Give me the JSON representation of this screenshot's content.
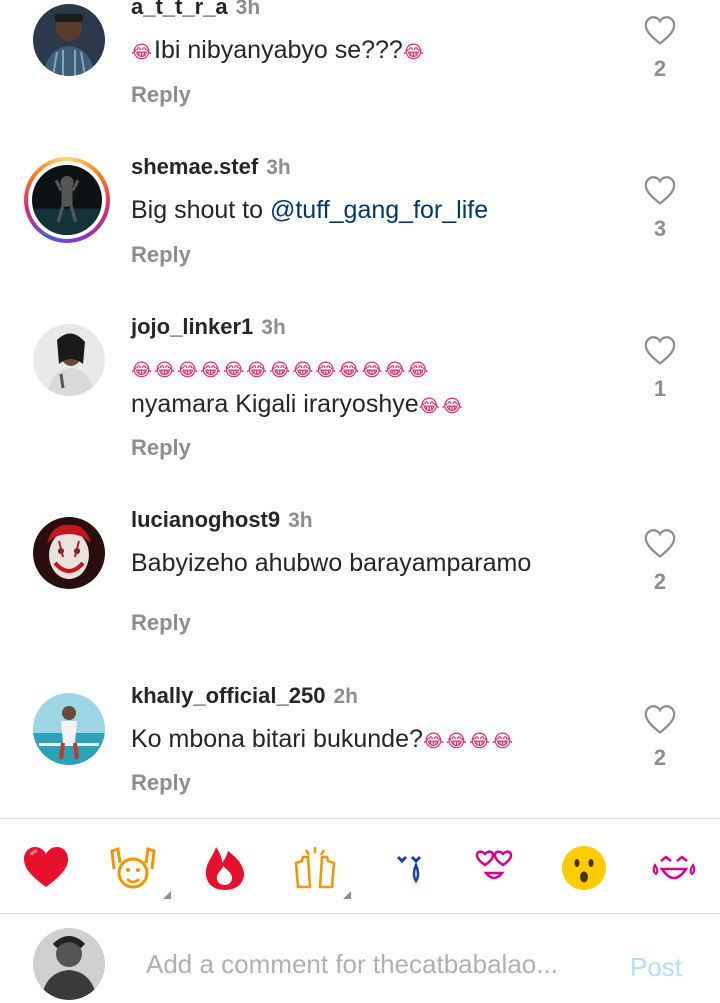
{
  "comments": [
    {
      "username": "a_t_t_r_a",
      "time": "3h",
      "text": "Ibi nibyanyabyo se???",
      "emoji_before": "😂",
      "emoji_after": "😂",
      "likes": "2",
      "reply": "Reply",
      "avatar": "man-in-plaid-shirt"
    },
    {
      "username": "shemae.stef",
      "time": "3h",
      "text_prefix": "Big shout to ",
      "mention": "@tuff_gang_for_life",
      "likes": "3",
      "reply": "Reply",
      "avatar": "silhouette-story-ring"
    },
    {
      "username": "jojo_linker1",
      "time": "3h",
      "emoji_line": "😂😂😂😂😂😂😂😂😂😂😂😂😂",
      "text": "nyamara Kigali iraryoshye",
      "emoji_after": "😂😂",
      "likes": "1",
      "reply": "Reply",
      "avatar": "woman-portrait"
    },
    {
      "username": "lucianoghost9",
      "time": "3h",
      "text": "Babyizeho ahubwo barayamparamo",
      "likes": "2",
      "reply": "Reply",
      "avatar": "clown-face"
    },
    {
      "username": "khally_official_250",
      "time": "2h",
      "text": "Ko mbona bitari bukunde?",
      "emoji_after": "😂😂😂😂",
      "likes": "2",
      "reply": "Reply",
      "avatar": "man-by-water"
    }
  ],
  "emoji_bar": [
    {
      "name": "red-heart-emoji",
      "glyph": "❤️"
    },
    {
      "name": "raising-hands-emoji",
      "glyph": "🙌"
    },
    {
      "name": "fire-emoji",
      "glyph": "🔥"
    },
    {
      "name": "clapping-hands-emoji",
      "glyph": "👏"
    },
    {
      "name": "crying-face-emoji",
      "glyph": "😢"
    },
    {
      "name": "heart-eyes-emoji",
      "glyph": "😍"
    },
    {
      "name": "astonished-face-emoji",
      "glyph": "😮"
    },
    {
      "name": "laughing-tears-emoji",
      "glyph": "😂"
    }
  ],
  "composer": {
    "placeholder": "Add a comment for thecatbabalao...",
    "post_label": "Post"
  },
  "colors": {
    "mention": "#00376b",
    "muted": "#8e8e8e",
    "post_disabled": "#b2dffc",
    "emoji_pink": "#e1306c"
  }
}
